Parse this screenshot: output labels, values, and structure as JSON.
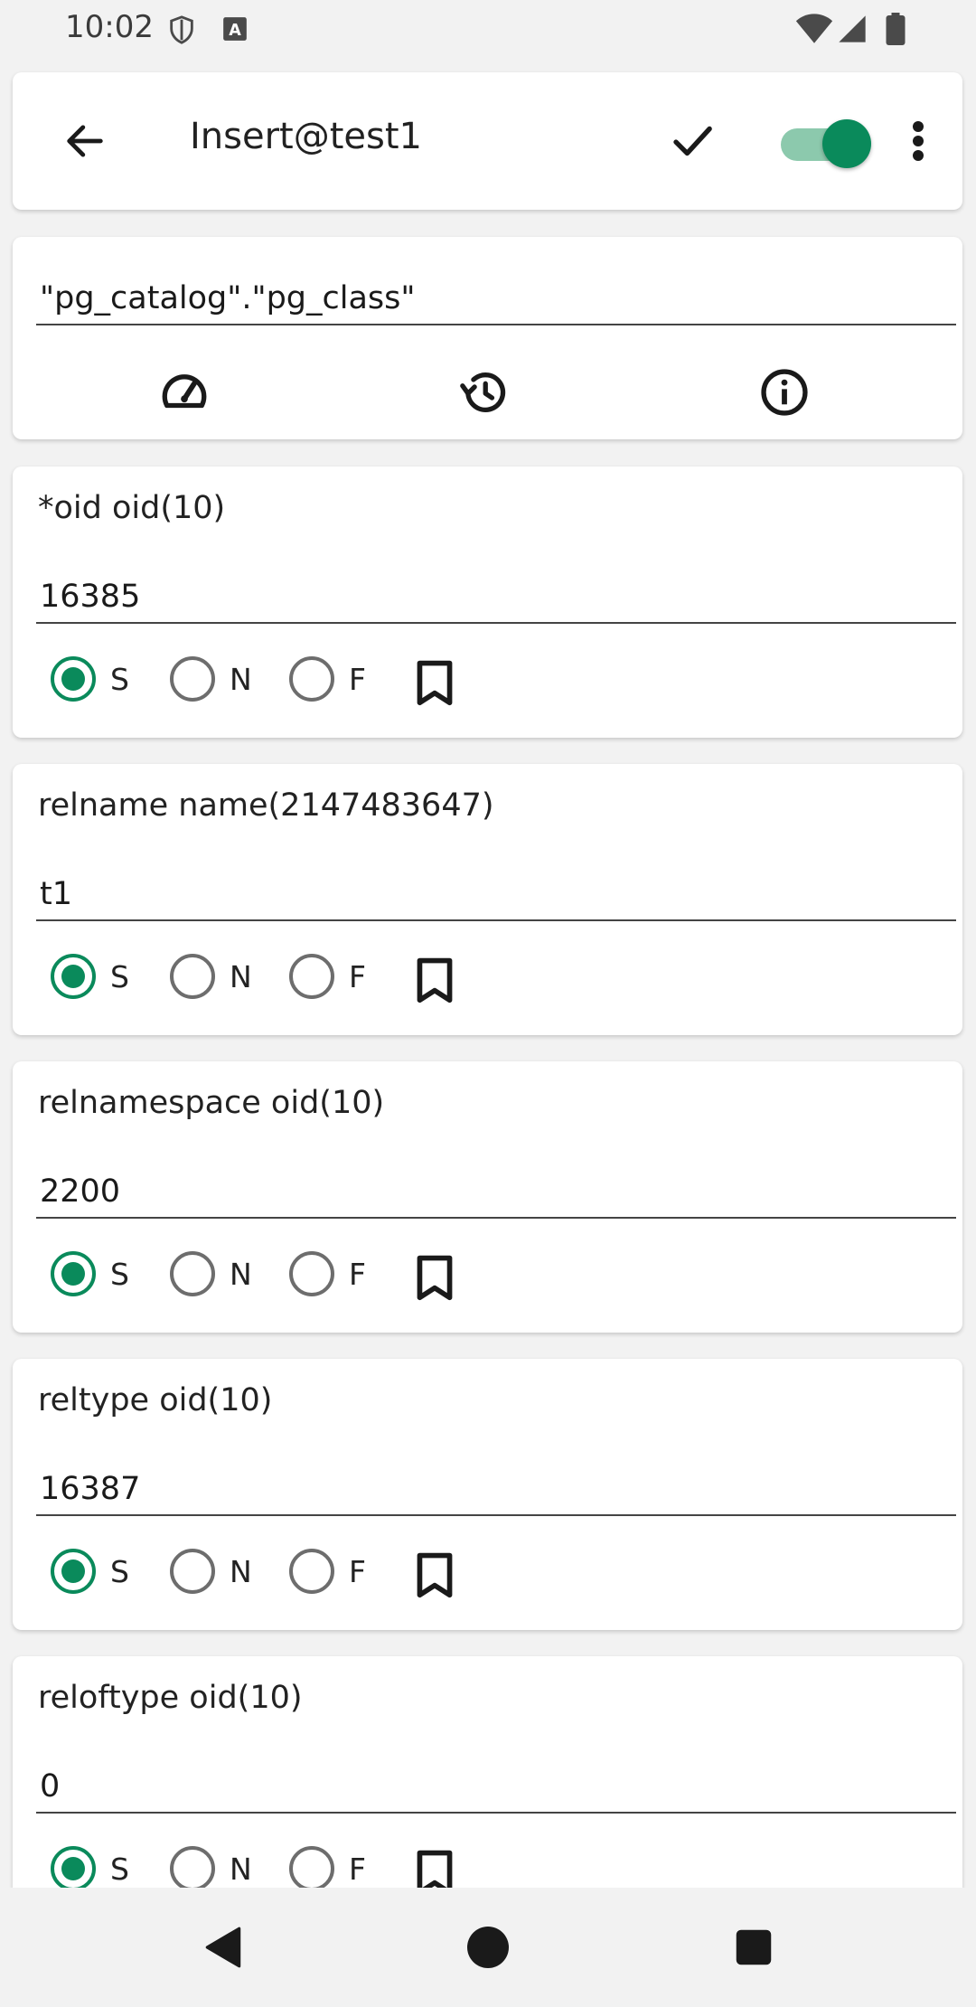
{
  "status": {
    "time": "10:02"
  },
  "toolbar": {
    "title": "Insert@test1",
    "toggle_on": true
  },
  "table": {
    "name": "\"pg_catalog\".\"pg_class\""
  },
  "radio_labels": {
    "s": "S",
    "n": "N",
    "f": "F"
  },
  "fields": [
    {
      "label": "*oid oid(10)",
      "value": "16385",
      "selected": "S"
    },
    {
      "label": "relname name(2147483647)",
      "value": "t1",
      "selected": "S"
    },
    {
      "label": "relnamespace oid(10)",
      "value": "2200",
      "selected": "S"
    },
    {
      "label": "reltype oid(10)",
      "value": "16387",
      "selected": "S"
    },
    {
      "label": "reloftype oid(10)",
      "value": "0",
      "selected": "S"
    }
  ],
  "colors": {
    "accent": "#0a8a5b",
    "accent_track": "#8cc9ad"
  },
  "icons": {
    "toolbar": [
      "back-arrow-icon",
      "check-icon",
      "toggle-switch",
      "more-vert-icon"
    ],
    "table_actions": [
      "speed-icon",
      "history-icon",
      "info-icon"
    ],
    "field_actions": [
      "bookmark-icon"
    ],
    "navigation": [
      "nav-back-icon",
      "nav-home-icon",
      "nav-recents-icon"
    ]
  }
}
